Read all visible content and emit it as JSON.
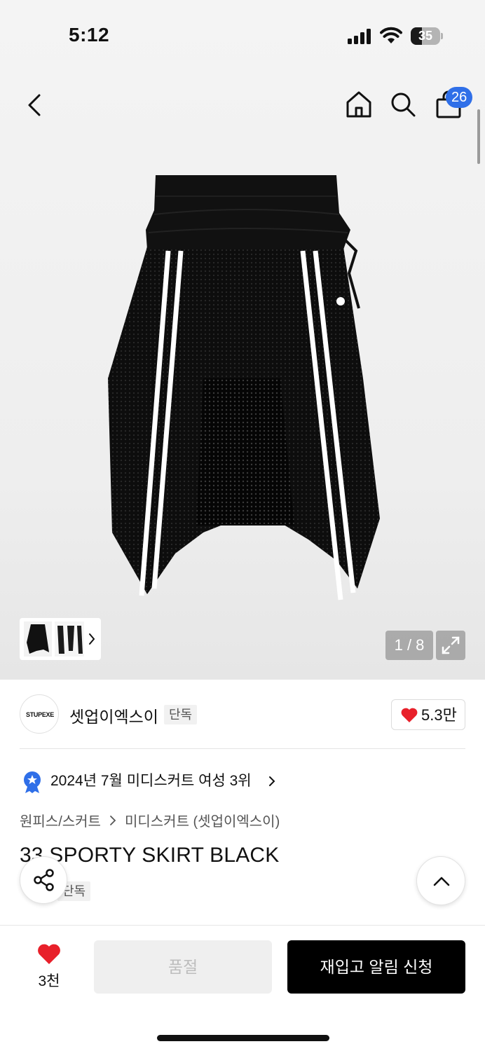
{
  "status_bar": {
    "time": "5:12",
    "battery": "35"
  },
  "header": {
    "cart_count": "26"
  },
  "gallery": {
    "counter": "1 / 8"
  },
  "brand": {
    "logo_text": "STUPEXE",
    "name": "셋업이엑스이",
    "tag": "단독",
    "likes": "5.3만"
  },
  "ranking": {
    "text": "2024년 7월 미디스커트 여성 3위"
  },
  "breadcrumb": {
    "category": "원피스/스커트",
    "subcategory": "미디스커트 (셋업이엑스이)"
  },
  "product": {
    "title": "33 SPORTY SKIRT BLACK",
    "tag": "단독"
  },
  "bottom_bar": {
    "wish_count": "3천",
    "soldout_label": "품절",
    "restock_label": "재입고 알림 신청"
  },
  "colors": {
    "accent_blue": "#2f6fe8",
    "heart_red": "#e8202a",
    "primary_black": "#000000"
  },
  "icons": [
    "back-arrow-icon",
    "home-icon",
    "search-icon",
    "shopping-bag-icon",
    "expand-icon",
    "heart-icon",
    "ranking-badge-icon",
    "share-icon",
    "chevron-up-icon"
  ]
}
